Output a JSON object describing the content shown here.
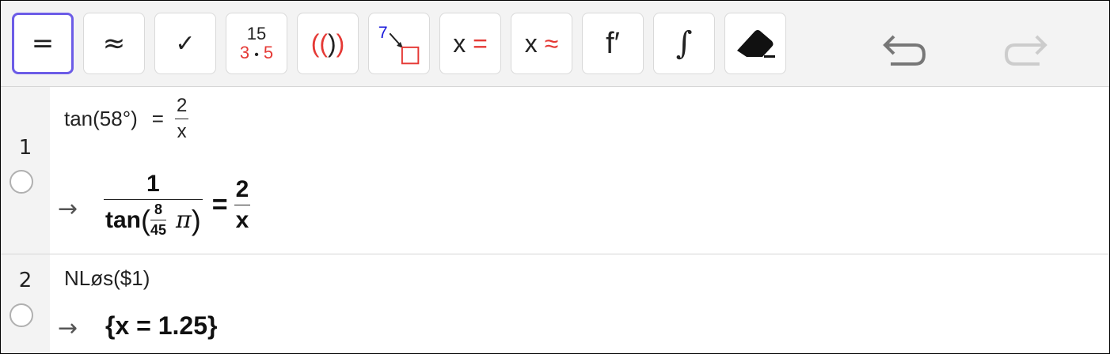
{
  "toolbar": {
    "buttons": [
      {
        "name": "evaluate",
        "label": "="
      },
      {
        "name": "numeric",
        "label": "≈"
      },
      {
        "name": "keep-input",
        "label": "✓"
      },
      {
        "name": "factor",
        "top": "15",
        "left": "3",
        "dot": "•",
        "right": "5"
      },
      {
        "name": "expand",
        "label_red": "((",
        "label_dark": ")",
        "label_red2": ")"
      },
      {
        "name": "substitute",
        "number": "7"
      },
      {
        "name": "solve",
        "x": "x",
        "sym": "="
      },
      {
        "name": "solve-numerically",
        "x": "x",
        "sym": "≈"
      },
      {
        "name": "derivative",
        "label": "f′"
      },
      {
        "name": "integral",
        "label": "∫"
      },
      {
        "name": "delete",
        "label": ""
      }
    ]
  },
  "rows": [
    {
      "number": "1",
      "input": {
        "lhs": "tan(58°)",
        "eq": "=",
        "num": "2",
        "den": "x"
      },
      "output": {
        "arrow": "→",
        "lhs_num": "1",
        "tan": "tan",
        "lparen": "(",
        "inner_num": "8",
        "inner_den": "45",
        "pi": "π",
        "rparen": ")",
        "eq": "=",
        "rhs_num": "2",
        "rhs_den": "x"
      }
    },
    {
      "number": "2",
      "input": {
        "text": "NLøs($1)"
      },
      "output": {
        "arrow": "→",
        "text": "{x = 1.25}"
      }
    }
  ],
  "colors": {
    "accent": "#6c5ce7",
    "red": "#e53935",
    "blue": "#1a1adb"
  }
}
